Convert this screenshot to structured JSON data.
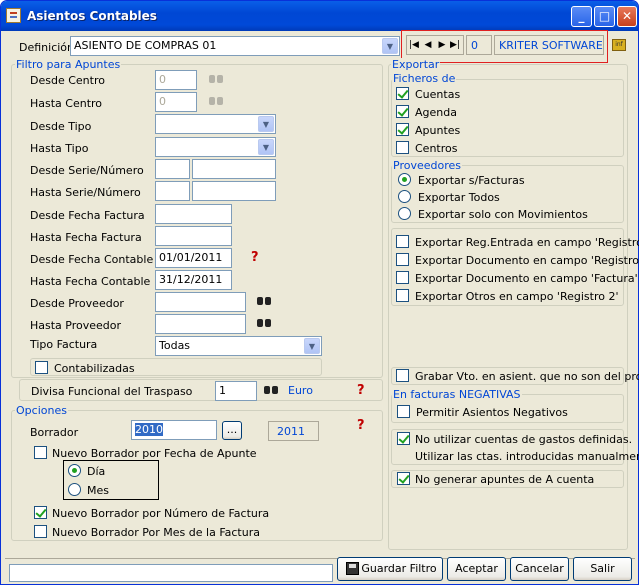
{
  "window": {
    "title": "Asientos Contables"
  },
  "definicion": {
    "label": "Definición",
    "value": "ASIENTO DE COMPRAS 01"
  },
  "nav": {
    "counter": "0",
    "brand": "KRITER SOFTWARE"
  },
  "filtro": {
    "title": "Filtro para Apuntes",
    "desde_centro": {
      "label": "Desde Centro",
      "value": "0"
    },
    "hasta_centro": {
      "label": "Hasta Centro",
      "value": "0"
    },
    "desde_tipo": {
      "label": "Desde Tipo",
      "value": ""
    },
    "hasta_tipo": {
      "label": "Hasta Tipo",
      "value": ""
    },
    "desde_serie": {
      "label": "Desde Serie/Número"
    },
    "hasta_serie": {
      "label": "Hasta Serie/Número"
    },
    "desde_fecha_factura": {
      "label": "Desde Fecha Factura",
      "value": ""
    },
    "hasta_fecha_factura": {
      "label": "Hasta Fecha Factura",
      "value": ""
    },
    "desde_fecha_contable": {
      "label": "Desde Fecha Contable",
      "value": "01/01/2011"
    },
    "hasta_fecha_contable": {
      "label": "Hasta Fecha Contable",
      "value": "31/12/2011"
    },
    "desde_proveedor": {
      "label": "Desde Proveedor",
      "value": ""
    },
    "hasta_proveedor": {
      "label": "Hasta Proveedor",
      "value": ""
    },
    "tipo_factura": {
      "label": "Tipo Factura",
      "value": "Todas"
    },
    "contabilizadas": {
      "label": "Contabilizadas",
      "checked": false
    }
  },
  "divisa": {
    "label": "Divisa Funcional del Traspaso",
    "value": "1",
    "name": "Euro"
  },
  "opciones": {
    "title": "Opciones",
    "borrador": {
      "label": "Borrador",
      "value": "2010",
      "year": "2011",
      "ellipsis": "..."
    },
    "nuevo_fecha_apunte": {
      "label": "Nuevo Borrador por Fecha de Apunte",
      "checked": false
    },
    "dia": {
      "label": "Día",
      "selected": true
    },
    "mes": {
      "label": "Mes",
      "selected": false
    },
    "nuevo_numero_factura": {
      "label": "Nuevo Borrador por Número de Factura",
      "checked": true
    },
    "nuevo_mes_factura": {
      "label": "Nuevo Borrador Por Mes de la Factura",
      "checked": false
    }
  },
  "exportar": {
    "title": "Exportar",
    "ficheros_title": "Ficheros de",
    "ficheros": [
      {
        "label": "Cuentas",
        "checked": true
      },
      {
        "label": "Agenda",
        "checked": true
      },
      {
        "label": "Apuntes",
        "checked": true
      },
      {
        "label": "Centros",
        "checked": false
      }
    ],
    "proveedores_title": "Proveedores",
    "proveedores": [
      {
        "label": "Exportar s/Facturas",
        "selected": true
      },
      {
        "label": "Exportar Todos",
        "selected": false
      },
      {
        "label": "Exportar solo con Movimientos",
        "selected": false
      }
    ],
    "campos": [
      {
        "label": "Exportar Reg.Entrada en campo 'Registro'",
        "checked": false
      },
      {
        "label": "Exportar Documento en campo 'Registro'",
        "checked": false
      },
      {
        "label": "Exportar Documento en campo 'Factura'",
        "checked": false
      },
      {
        "label": "Exportar Otros en campo 'Registro 2'",
        "checked": false
      }
    ],
    "grabar_vto": {
      "label": "Grabar Vto. en asient. que no son del prov.",
      "checked": false
    },
    "negativas_title": "En facturas NEGATIVAS",
    "permitir_negativos": {
      "label": "Permitir Asientos Negativos",
      "checked": false
    },
    "no_cuentas_gastos": {
      "label": "No utilizar cuentas de gastos definidas.",
      "label2": "Utilizar las ctas. introducidas manualmente.",
      "checked": true
    },
    "no_apuntes_cuenta": {
      "label": "No generar apuntes de A cuenta",
      "checked": true
    }
  },
  "footer": {
    "status": "",
    "guardar": "Guardar Filtro",
    "aceptar": "Aceptar",
    "cancelar": "Cancelar",
    "salir": "Salir"
  }
}
